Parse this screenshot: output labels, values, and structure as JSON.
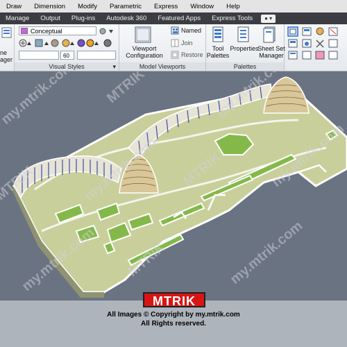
{
  "menubar": {
    "items": [
      "Draw",
      "Dimension",
      "Modify",
      "Parametric",
      "Express",
      "Window",
      "Help"
    ]
  },
  "tabs": {
    "items": [
      "Manage",
      "Output",
      "Plug-ins",
      "Autodesk 360",
      "Featured Apps",
      "Express Tools"
    ]
  },
  "ribbon": {
    "left_label_1": "ne",
    "left_label_2": "ager",
    "visual_style_value": "Conceptual",
    "small_field_value": "60",
    "visual_styles_title": "Visual Styles",
    "viewport_config_label_1": "Viewport",
    "viewport_config_label_2": "Configuration",
    "named_label": "Named",
    "join_label": "Join",
    "restore_label": "Restore",
    "model_viewports_title": "Model Viewports",
    "tool_palettes_label_1": "Tool",
    "tool_palettes_label_2": "Palettes",
    "properties_label": "Properties",
    "sheet_set_label_1": "Sheet Set",
    "sheet_set_label_2": "Manager",
    "palettes_title": "Palettes"
  },
  "watermark": {
    "text": "my.mtrik.com",
    "brand": "MTRIK"
  },
  "footer": {
    "brand": "MTRIK",
    "line1": "All Images © Copyright by my.mtrik.com",
    "line2": "All Rights reserved."
  },
  "colors": {
    "accent": "#2b6fd6",
    "ground": "#c9cf9a",
    "green": "#84b94a",
    "viewport_bg": "#6a7382",
    "brand_red": "#d81515"
  }
}
